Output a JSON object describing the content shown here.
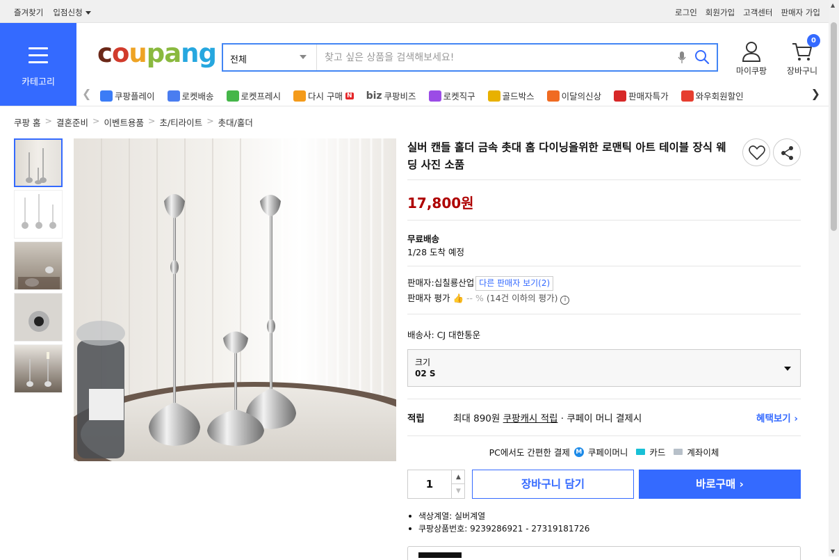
{
  "topbar": {
    "left": [
      "즐겨찾기",
      "입점신청"
    ],
    "right": [
      "로그인",
      "회원가입",
      "고객센터",
      "판매자 가입"
    ]
  },
  "category_label": "카테고리",
  "logo_text": "coupang",
  "search": {
    "category": "전체",
    "placeholder": "찾고 싶은 상품을 검색해보세요!"
  },
  "account": {
    "mypage": "마이쿠팡",
    "cart": "장바구니",
    "cart_count": "0"
  },
  "nav_items": [
    {
      "label": "쿠팡플레이",
      "icon": "play-icon",
      "color": "#3b7cf6"
    },
    {
      "label": "로켓배송",
      "icon": "rocket-icon",
      "color": "#4a7df0"
    },
    {
      "label": "로켓프레시",
      "icon": "fresh-rocket-icon",
      "color": "#45b649"
    },
    {
      "label": "다시 구매",
      "icon": "rebuy-icon",
      "color": "#f49b1b",
      "tag": "N"
    },
    {
      "label": "쿠팡비즈",
      "icon": "biz-icon",
      "color": "#555",
      "prefix": "biz"
    },
    {
      "label": "로켓직구",
      "icon": "global-rocket-icon",
      "color": "#9b4ce6"
    },
    {
      "label": "골드박스",
      "icon": "goldbox-icon",
      "color": "#e8b100"
    },
    {
      "label": "이달의신상",
      "icon": "new-bag-icon",
      "color": "#f06b22"
    },
    {
      "label": "판매자특가",
      "icon": "percent-icon",
      "color": "#d72828"
    },
    {
      "label": "와우회원할인",
      "icon": "wow-icon",
      "color": "#e63e2f"
    }
  ],
  "breadcrumb": [
    "쿠팡 홈",
    "결혼준비",
    "이벤트용품",
    "초/티라이트",
    "촛대/홀더"
  ],
  "product": {
    "title": "실버 캔들 홀더 금속 촛대 홈 다이닝을위한 로맨틱 아트 테이블 장식 웨딩 사진 소품",
    "price": "17,800원",
    "shipping_label": "무료배송",
    "arrival": "1/28 도착 예정",
    "seller_prefix": "판매자:",
    "seller_name": "십칠룡산업",
    "other_sellers": "다른 판매자 보기(2)",
    "rating_label": "판매자 평가",
    "rating_value": "-- %",
    "rating_note": "(14건 이하의 평가)",
    "carrier": "배송사:  CJ 대한통운",
    "option_label": "크기",
    "option_value": "02 S",
    "reward_label": "적립",
    "reward_text1": "최대 890원",
    "reward_link": "쿠팡캐시 적립",
    "reward_text2": "· 쿠페이 머니 결제시",
    "reward_more": "혜택보기",
    "pay_title": "PC에서도 간편한 결제",
    "pay_opts": [
      "쿠페이머니",
      "카드",
      "계좌이체"
    ],
    "quantity": "1",
    "add_cart": "장바구니 담기",
    "buy_now": "바로구매",
    "details": [
      "색상계열: 실버계열",
      "쿠팡상품번호: 9239286921 - 27319181726"
    ]
  },
  "colors": {
    "accent": "#346aff",
    "price": "#ae0000"
  }
}
